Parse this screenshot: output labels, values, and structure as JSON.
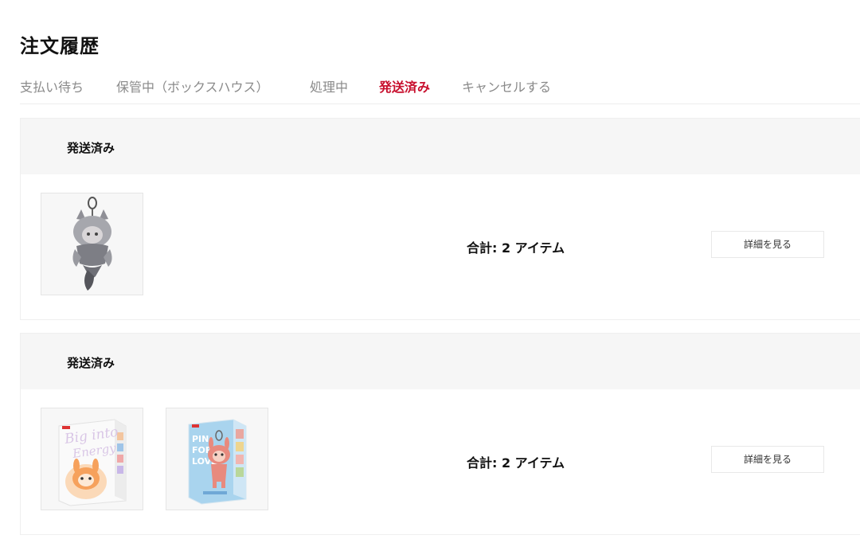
{
  "page": {
    "title": "注文履歴"
  },
  "tabs": [
    {
      "label": "支払い待ち",
      "active": false
    },
    {
      "label": "保管中（ボックスハウス）",
      "active": false
    },
    {
      "label": "処理中",
      "active": false
    },
    {
      "label": "発送済み",
      "active": true
    },
    {
      "label": "キャンセルする",
      "active": false
    }
  ],
  "colors": {
    "accent": "#c8102e",
    "header_bg": "#f6f6f6",
    "muted_text": "#8a8a8a"
  },
  "orders": [
    {
      "status": "発送済み",
      "total": "合計: 2 アイテム",
      "detail_label": "詳細を見る",
      "items": [
        {
          "image": "silver-figure-keychain"
        }
      ]
    },
    {
      "status": "発送済み",
      "total": "合計: 2 アイテム",
      "detail_label": "詳細を見る",
      "items": [
        {
          "image": "orange-blind-box"
        },
        {
          "image": "blue-blind-box"
        }
      ]
    }
  ]
}
